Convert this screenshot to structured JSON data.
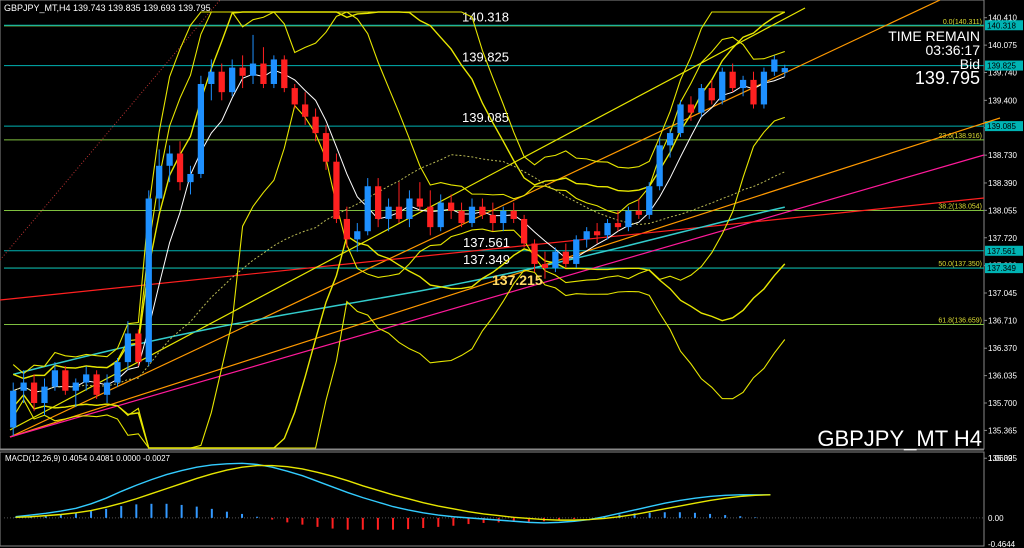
{
  "header": {
    "symbol_line": "GBPJPY_MT,H4  139.743 139.835 139.693 139.795"
  },
  "info": {
    "time_remain_label": "TIME REMAIN",
    "time_remain_value": "03:36:17",
    "bid_label": "Bid",
    "bid_value": "139.795",
    "symbol_label": "GBPJPY_MT H4"
  },
  "colors": {
    "background": "#000000",
    "bull": "#1e90ff",
    "bear": "#ff2020",
    "bollinger": "#e6e600",
    "level_line": "#00b3b3",
    "fib_line": "#7fbf3f",
    "trend_orange": "#ff9900",
    "trend_red": "#ff2020",
    "trend_magenta": "#ff1a9a",
    "trend_yellow": "#e6e600",
    "ma_aqua": "#33cccc",
    "macd_line": "#33ccff",
    "signal_line": "#e6e600"
  },
  "chart_data": [
    {
      "type": "candlestick",
      "title": "GBPJPY_MT H4",
      "ylim": [
        135.15,
        140.48
      ],
      "y_ticks": [
        "140.410",
        "140.075",
        "139.740",
        "139.400",
        "139.065",
        "138.730",
        "138.390",
        "138.055",
        "137.720",
        "137.380",
        "137.045",
        "136.710",
        "136.370",
        "136.035",
        "135.700",
        "135.365",
        "135.025"
      ],
      "axis_marks": [
        {
          "value": 140.318,
          "label": "140.318"
        },
        {
          "value": 139.825,
          "label": "139.825"
        },
        {
          "value": 139.085,
          "label": "139.085"
        },
        {
          "value": 137.561,
          "label": "137.561"
        },
        {
          "value": 137.349,
          "label": "137.349"
        }
      ],
      "levels": [
        {
          "value": 140.318,
          "label": "140.318"
        },
        {
          "value": 139.825,
          "label": "139.825"
        },
        {
          "value": 139.085,
          "label": "139.085"
        },
        {
          "value": 137.561,
          "label": "137.561"
        },
        {
          "value": 137.349,
          "label": "137.349"
        }
      ],
      "fib_levels": [
        {
          "value": 140.311,
          "label": "0.0(140.311)"
        },
        {
          "value": 138.916,
          "label": "23.6(138.916)"
        },
        {
          "value": 138.054,
          "label": "38.2(138.054)"
        },
        {
          "value": 137.35,
          "label": "50.0(137.350)"
        },
        {
          "value": 136.659,
          "label": "61.8(136.659)"
        }
      ],
      "low_annotation": {
        "value": 137.215,
        "label": "137.215"
      },
      "candles": [
        {
          "o": 135.4,
          "h": 135.95,
          "l": 135.3,
          "c": 135.85
        },
        {
          "o": 135.85,
          "h": 136.1,
          "l": 135.7,
          "c": 135.95
        },
        {
          "o": 135.95,
          "h": 136.05,
          "l": 135.6,
          "c": 135.7
        },
        {
          "o": 135.7,
          "h": 136.0,
          "l": 135.55,
          "c": 135.9
        },
        {
          "o": 135.9,
          "h": 136.2,
          "l": 135.85,
          "c": 136.1
        },
        {
          "o": 136.1,
          "h": 136.15,
          "l": 135.8,
          "c": 135.85
        },
        {
          "o": 135.85,
          "h": 136.0,
          "l": 135.65,
          "c": 135.95
        },
        {
          "o": 135.95,
          "h": 136.15,
          "l": 135.85,
          "c": 136.05
        },
        {
          "o": 136.05,
          "h": 136.1,
          "l": 135.75,
          "c": 135.8
        },
        {
          "o": 135.8,
          "h": 136.05,
          "l": 135.7,
          "c": 135.95
        },
        {
          "o": 135.95,
          "h": 136.25,
          "l": 135.9,
          "c": 136.2
        },
        {
          "o": 136.2,
          "h": 136.7,
          "l": 136.1,
          "c": 136.55
        },
        {
          "o": 136.55,
          "h": 136.6,
          "l": 136.15,
          "c": 136.2
        },
        {
          "o": 136.2,
          "h": 138.3,
          "l": 136.15,
          "c": 138.2
        },
        {
          "o": 138.2,
          "h": 138.8,
          "l": 138.05,
          "c": 138.6
        },
        {
          "o": 138.6,
          "h": 138.85,
          "l": 138.4,
          "c": 138.75
        },
        {
          "o": 138.75,
          "h": 138.9,
          "l": 138.3,
          "c": 138.4
        },
        {
          "o": 138.4,
          "h": 138.6,
          "l": 138.25,
          "c": 138.5
        },
        {
          "o": 138.5,
          "h": 139.7,
          "l": 138.45,
          "c": 139.6
        },
        {
          "o": 139.6,
          "h": 139.9,
          "l": 139.4,
          "c": 139.75
        },
        {
          "o": 139.75,
          "h": 139.85,
          "l": 139.4,
          "c": 139.5
        },
        {
          "o": 139.5,
          "h": 139.9,
          "l": 139.45,
          "c": 139.8
        },
        {
          "o": 139.8,
          "h": 139.95,
          "l": 139.55,
          "c": 139.7
        },
        {
          "o": 139.7,
          "h": 140.2,
          "l": 139.6,
          "c": 139.85
        },
        {
          "o": 139.85,
          "h": 140.05,
          "l": 139.55,
          "c": 139.6
        },
        {
          "o": 139.6,
          "h": 139.95,
          "l": 139.55,
          "c": 139.9
        },
        {
          "o": 139.9,
          "h": 139.95,
          "l": 139.5,
          "c": 139.55
        },
        {
          "o": 139.55,
          "h": 139.6,
          "l": 139.3,
          "c": 139.35
        },
        {
          "o": 139.35,
          "h": 139.5,
          "l": 139.1,
          "c": 139.2
        },
        {
          "o": 139.2,
          "h": 139.3,
          "l": 138.9,
          "c": 139.0
        },
        {
          "o": 139.0,
          "h": 139.1,
          "l": 138.55,
          "c": 138.65
        },
        {
          "o": 138.65,
          "h": 138.75,
          "l": 137.9,
          "c": 137.95
        },
        {
          "o": 137.95,
          "h": 138.1,
          "l": 137.6,
          "c": 137.7
        },
        {
          "o": 137.7,
          "h": 137.9,
          "l": 137.55,
          "c": 137.8
        },
        {
          "o": 137.8,
          "h": 138.45,
          "l": 137.75,
          "c": 138.35
        },
        {
          "o": 138.35,
          "h": 138.45,
          "l": 137.85,
          "c": 137.95
        },
        {
          "o": 137.95,
          "h": 138.2,
          "l": 137.8,
          "c": 138.1
        },
        {
          "o": 138.1,
          "h": 138.4,
          "l": 137.9,
          "c": 137.95
        },
        {
          "o": 137.95,
          "h": 138.3,
          "l": 137.85,
          "c": 138.2
        },
        {
          "o": 138.2,
          "h": 138.4,
          "l": 138.05,
          "c": 138.1
        },
        {
          "o": 138.1,
          "h": 138.3,
          "l": 137.75,
          "c": 137.85
        },
        {
          "o": 137.85,
          "h": 138.25,
          "l": 137.8,
          "c": 138.15
        },
        {
          "o": 138.15,
          "h": 138.25,
          "l": 137.95,
          "c": 138.05
        },
        {
          "o": 138.05,
          "h": 138.15,
          "l": 137.85,
          "c": 137.9
        },
        {
          "o": 137.9,
          "h": 138.2,
          "l": 137.85,
          "c": 138.1
        },
        {
          "o": 138.1,
          "h": 138.2,
          "l": 137.95,
          "c": 138.0
        },
        {
          "o": 138.0,
          "h": 138.15,
          "l": 137.8,
          "c": 137.9
        },
        {
          "o": 137.9,
          "h": 138.1,
          "l": 137.8,
          "c": 138.05
        },
        {
          "o": 138.05,
          "h": 138.15,
          "l": 137.9,
          "c": 137.95
        },
        {
          "o": 137.95,
          "h": 138.0,
          "l": 137.6,
          "c": 137.65
        },
        {
          "o": 137.65,
          "h": 137.7,
          "l": 137.3,
          "c": 137.4
        },
        {
          "o": 137.4,
          "h": 137.55,
          "l": 137.22,
          "c": 137.35
        },
        {
          "o": 137.35,
          "h": 137.6,
          "l": 137.3,
          "c": 137.55
        },
        {
          "o": 137.55,
          "h": 137.65,
          "l": 137.35,
          "c": 137.4
        },
        {
          "o": 137.4,
          "h": 137.75,
          "l": 137.35,
          "c": 137.7
        },
        {
          "o": 137.7,
          "h": 137.85,
          "l": 137.6,
          "c": 137.8
        },
        {
          "o": 137.8,
          "h": 137.9,
          "l": 137.65,
          "c": 137.75
        },
        {
          "o": 137.75,
          "h": 137.95,
          "l": 137.7,
          "c": 137.9
        },
        {
          "o": 137.9,
          "h": 138.05,
          "l": 137.8,
          "c": 137.85
        },
        {
          "o": 137.85,
          "h": 138.1,
          "l": 137.8,
          "c": 138.05
        },
        {
          "o": 138.05,
          "h": 138.2,
          "l": 137.95,
          "c": 138.0
        },
        {
          "o": 138.0,
          "h": 138.4,
          "l": 137.95,
          "c": 138.35
        },
        {
          "o": 138.35,
          "h": 138.95,
          "l": 138.3,
          "c": 138.85
        },
        {
          "o": 138.85,
          "h": 139.05,
          "l": 138.7,
          "c": 139.0
        },
        {
          "o": 139.0,
          "h": 139.4,
          "l": 138.95,
          "c": 139.35
        },
        {
          "o": 139.35,
          "h": 139.45,
          "l": 139.15,
          "c": 139.25
        },
        {
          "o": 139.25,
          "h": 139.6,
          "l": 139.2,
          "c": 139.55
        },
        {
          "o": 139.55,
          "h": 139.65,
          "l": 139.35,
          "c": 139.4
        },
        {
          "o": 139.4,
          "h": 139.8,
          "l": 139.35,
          "c": 139.75
        },
        {
          "o": 139.75,
          "h": 139.85,
          "l": 139.5,
          "c": 139.55
        },
        {
          "o": 139.55,
          "h": 139.7,
          "l": 139.45,
          "c": 139.65
        },
        {
          "o": 139.65,
          "h": 139.75,
          "l": 139.3,
          "c": 139.35
        },
        {
          "o": 139.35,
          "h": 139.8,
          "l": 139.3,
          "c": 139.75
        },
        {
          "o": 139.75,
          "h": 139.95,
          "l": 139.7,
          "c": 139.9
        },
        {
          "o": 139.743,
          "h": 139.835,
          "l": 139.693,
          "c": 139.795
        }
      ]
    },
    {
      "type": "line",
      "title": "MACD(12,26,9) 0.4054 0.4081 0.0000 -0.0027",
      "ylim": [
        -0.4644,
        1.0639
      ],
      "y_ticks": [
        "1.0639",
        "0.00",
        "-0.4644"
      ],
      "series": [
        {
          "name": "MACD",
          "values": [
            0.02,
            0.05,
            0.08,
            0.12,
            0.17,
            0.25,
            0.35,
            0.47,
            0.58,
            0.68,
            0.77,
            0.84,
            0.9,
            0.94,
            0.96,
            0.97,
            0.95,
            0.9,
            0.83,
            0.75,
            0.65,
            0.55,
            0.45,
            0.36,
            0.28,
            0.2,
            0.14,
            0.09,
            0.05,
            0.02,
            0.0,
            -0.02,
            -0.04,
            -0.06,
            -0.08,
            -0.09,
            -0.08,
            -0.06,
            -0.03,
            0.02,
            0.08,
            0.14,
            0.2,
            0.26,
            0.31,
            0.35,
            0.38,
            0.4,
            0.41,
            0.41,
            0.41
          ]
        },
        {
          "name": "Signal",
          "values": [
            0.01,
            0.02,
            0.04,
            0.06,
            0.09,
            0.13,
            0.19,
            0.26,
            0.34,
            0.43,
            0.52,
            0.61,
            0.7,
            0.78,
            0.85,
            0.9,
            0.93,
            0.93,
            0.91,
            0.87,
            0.81,
            0.74,
            0.66,
            0.57,
            0.49,
            0.41,
            0.34,
            0.27,
            0.21,
            0.16,
            0.11,
            0.07,
            0.04,
            0.01,
            -0.01,
            -0.03,
            -0.04,
            -0.04,
            -0.03,
            -0.01,
            0.02,
            0.06,
            0.11,
            0.16,
            0.21,
            0.26,
            0.31,
            0.35,
            0.38,
            0.4,
            0.41
          ]
        },
        {
          "name": "Histogram",
          "values": [
            0.01,
            0.03,
            0.04,
            0.06,
            0.08,
            0.12,
            0.16,
            0.21,
            0.24,
            0.25,
            0.25,
            0.23,
            0.2,
            0.16,
            0.11,
            0.07,
            0.02,
            -0.03,
            -0.08,
            -0.12,
            -0.16,
            -0.19,
            -0.21,
            -0.21,
            -0.21,
            -0.21,
            -0.2,
            -0.18,
            -0.16,
            -0.14,
            -0.11,
            -0.09,
            -0.08,
            -0.07,
            -0.07,
            -0.06,
            -0.04,
            -0.02,
            0.0,
            0.03,
            0.06,
            0.08,
            0.09,
            0.1,
            0.1,
            0.09,
            0.07,
            0.05,
            0.03,
            0.01,
            0.0
          ]
        }
      ]
    }
  ]
}
